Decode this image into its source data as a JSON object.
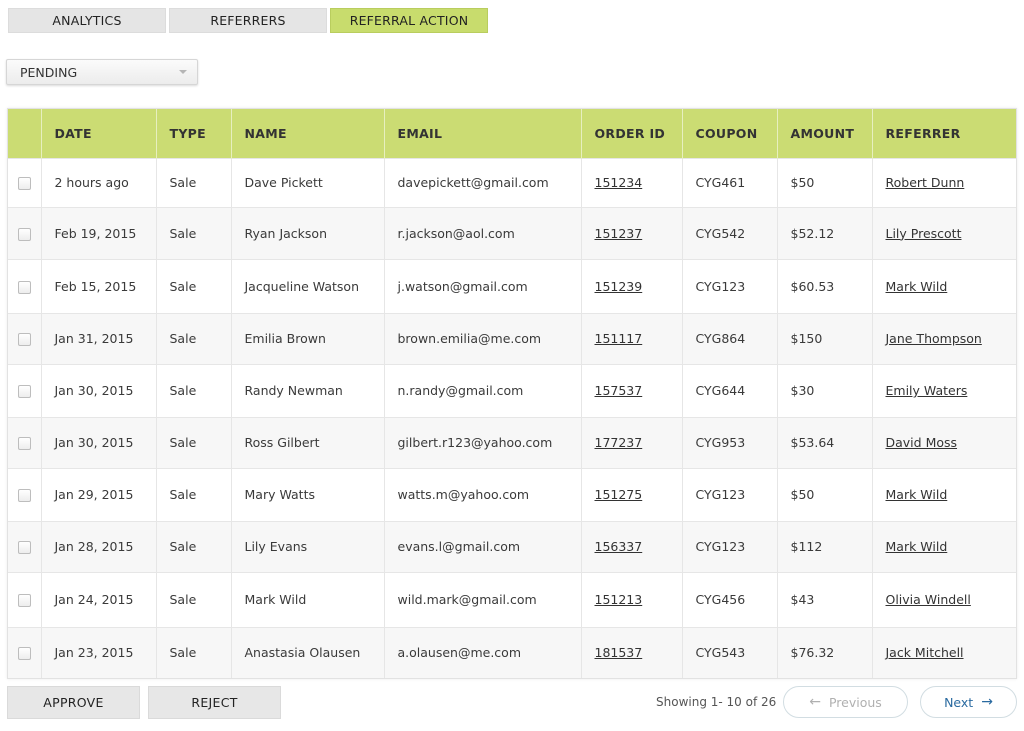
{
  "tabs": [
    {
      "label": "ANALYTICS",
      "active": false
    },
    {
      "label": "REFERRERS",
      "active": false
    },
    {
      "label": "REFERRAL ACTION",
      "active": true
    }
  ],
  "filter": {
    "selected": "PENDING"
  },
  "table": {
    "columns": [
      "DATE",
      "TYPE",
      "NAME",
      "EMAIL",
      "ORDER ID",
      "COUPON",
      "AMOUNT",
      "REFERRER"
    ],
    "rows": [
      {
        "date": "2 hours ago",
        "type": "Sale",
        "name": "Dave Pickett",
        "email": "davepickett@gmail.com",
        "order_id": "151234",
        "coupon": "CYG461",
        "amount": "$50",
        "referrer": "Robert Dunn"
      },
      {
        "date": "Feb 19, 2015",
        "type": "Sale",
        "name": "Ryan Jackson",
        "email": "r.jackson@aol.com",
        "order_id": "151237",
        "coupon": "CYG542",
        "amount": "$52.12",
        "referrer": "Lily Prescott"
      },
      {
        "date": "Feb 15, 2015",
        "type": "Sale",
        "name": "Jacqueline Watson",
        "email": "j.watson@gmail.com",
        "order_id": "151239",
        "coupon": "CYG123",
        "amount": "$60.53",
        "referrer": "Mark Wild"
      },
      {
        "date": "Jan 31, 2015",
        "type": "Sale",
        "name": "Emilia Brown",
        "email": "brown.emilia@me.com",
        "order_id": "151117",
        "coupon": "CYG864",
        "amount": "$150",
        "referrer": "Jane Thompson"
      },
      {
        "date": "Jan 30, 2015",
        "type": "Sale",
        "name": "Randy Newman",
        "email": "n.randy@gmail.com",
        "order_id": "157537",
        "coupon": "CYG644",
        "amount": "$30",
        "referrer": "Emily Waters"
      },
      {
        "date": "Jan 30, 2015",
        "type": "Sale",
        "name": "Ross Gilbert",
        "email": "gilbert.r123@yahoo.com",
        "order_id": "177237",
        "coupon": "CYG953",
        "amount": "$53.64",
        "referrer": "David Moss"
      },
      {
        "date": "Jan 29, 2015",
        "type": "Sale",
        "name": "Mary Watts",
        "email": "watts.m@yahoo.com",
        "order_id": "151275",
        "coupon": "CYG123",
        "amount": "$50",
        "referrer": "Mark Wild"
      },
      {
        "date": "Jan 28, 2015",
        "type": "Sale",
        "name": "Lily Evans",
        "email": "evans.l@gmail.com",
        "order_id": "156337",
        "coupon": "CYG123",
        "amount": "$112",
        "referrer": "Mark Wild"
      },
      {
        "date": "Jan 24, 2015",
        "type": "Sale",
        "name": "Mark Wild",
        "email": "wild.mark@gmail.com",
        "order_id": "151213",
        "coupon": "CYG456",
        "amount": "$43",
        "referrer": "Olivia Windell"
      },
      {
        "date": "Jan 23, 2015",
        "type": "Sale",
        "name": "Anastasia Olausen",
        "email": "a.olausen@me.com",
        "order_id": "181537",
        "coupon": "CYG543",
        "amount": "$76.32",
        "referrer": "Jack Mitchell"
      }
    ]
  },
  "actions": {
    "approve_label": "APPROVE",
    "reject_label": "REJECT"
  },
  "pagination": {
    "showing": "Showing 1- 10 of 26",
    "previous_label": "Previous",
    "next_label": "Next"
  },
  "icons": {
    "dropdown": "chevron-down-icon",
    "previous": "arrow-left-icon",
    "next": "arrow-right-icon"
  },
  "colors": {
    "accent": "#c8dc6d",
    "header": "#cbdc73",
    "next_text": "#2a6aa0"
  }
}
